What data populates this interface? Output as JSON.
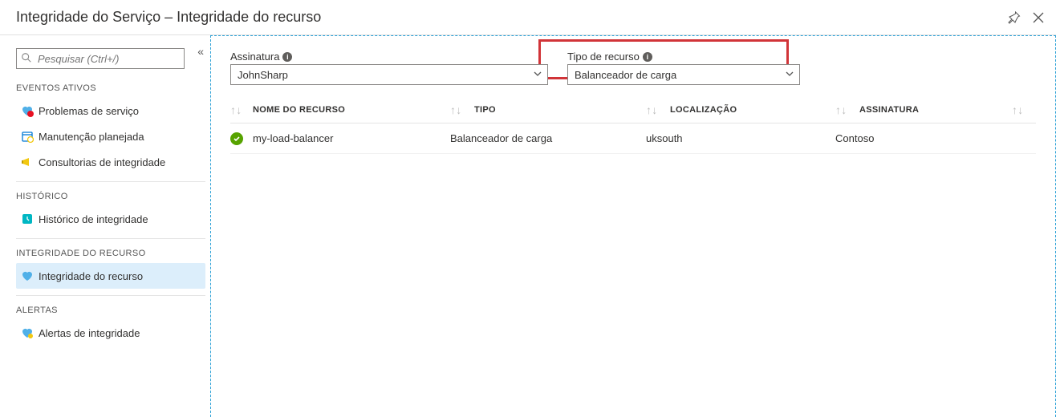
{
  "header": {
    "title": "Integridade do Serviço – Integridade do recurso"
  },
  "search": {
    "placeholder": "Pesquisar (Ctrl+/)"
  },
  "sidebar": {
    "sections": {
      "active": "EVENTOS ATIVOS",
      "history": "HISTÓRICO",
      "resource": "INTEGRIDADE DO RECURSO",
      "alerts": "ALERTAS"
    },
    "items": {
      "serviceIssues": "Problemas de serviço",
      "plannedMaintenance": "Manutenção planejada",
      "healthAdvisories": "Consultorias de integridade",
      "healthHistory": "Histórico de integridade",
      "resourceHealth": "Integridade do recurso",
      "healthAlerts": "Alertas de integridade"
    }
  },
  "filters": {
    "subscriptionLabel": "Assinatura",
    "subscriptionValue": "JohnSharp",
    "resourceTypeLabel": "Tipo de recurso",
    "resourceTypeValue": "Balanceador de carga"
  },
  "table": {
    "headers": {
      "name": "NOME DO RECURSO",
      "type": "TIPO",
      "location": "LOCALIZAÇÃO",
      "subscription": "ASSINATURA"
    },
    "rows": [
      {
        "name": "my-load-balancer",
        "type": "Balanceador de carga",
        "location": "uksouth",
        "subscription": "Contoso"
      }
    ]
  }
}
